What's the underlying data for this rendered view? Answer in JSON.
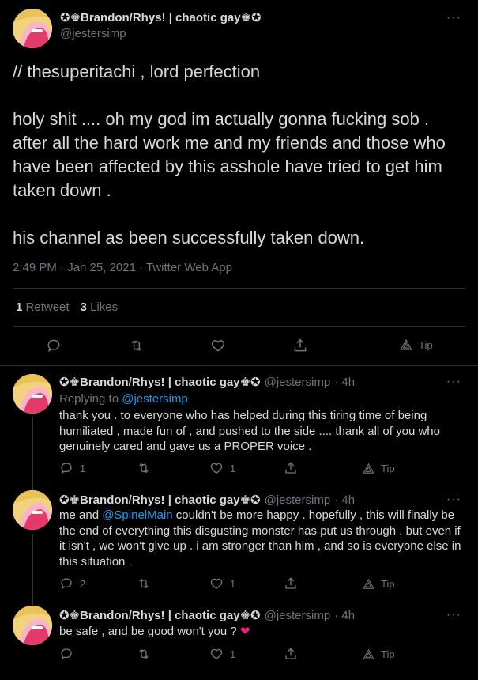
{
  "main_tweet": {
    "display_name": "✪♚Brandon/Rhys! | chaotic gay♚✪",
    "handle": "@jestersimp",
    "text": "// thesuperitachi , lord perfection\n\nholy shit .... oh my god im actually gonna fucking sob . after all the hard work me and my friends and those who have been affected by this asshole have tried to get him taken down .\n\nhis channel as been successfully taken down.",
    "time": "2:49 PM · Jan 25, 2021 · Twitter Web App",
    "retweets_count": "1",
    "retweets_label": "Retweet",
    "likes_count": "3",
    "likes_label": "Likes",
    "tip_label": "Tip"
  },
  "replies": [
    {
      "display_name": "✪♚Brandon/Rhys! | chaotic gay♚✪",
      "handle": "@jestersimp",
      "time": "· 4h",
      "replying_prefix": "Replying to",
      "replying_to": "@jestersimp",
      "text": "thank you . to everyone who has helped during this tiring time of being humiliated , made fun of , and pushed to the side .... thank all of you who genuinely cared and gave us a PROPER voice .",
      "reply_count": "1",
      "retweet_count": "",
      "like_count": "1",
      "tip_label": "Tip"
    },
    {
      "display_name": "✪♚Brandon/Rhys! | chaotic gay♚✪",
      "handle": "@jestersimp",
      "time": "· 4h",
      "text_before": "me and ",
      "mention": "@SpinelMain",
      "text_after": " couldn't be more happy . hopefully , this will finally be the end of everything this disgusting monster has put us through . but even if it isn't , we won't give up . i am stronger than him , and so is everyone else in this situation .",
      "reply_count": "2",
      "retweet_count": "",
      "like_count": "1",
      "tip_label": "Tip"
    },
    {
      "display_name": "✪♚Brandon/Rhys! | chaotic gay♚✪",
      "handle": "@jestersimp",
      "time": "· 4h",
      "text": "be safe , and be good won't you ?",
      "emoji": "❤",
      "reply_count": "",
      "retweet_count": "",
      "like_count": "1",
      "tip_label": "Tip"
    }
  ],
  "colors": {
    "background": "#000000",
    "text": "#d9d9d9",
    "secondary": "#6e767d",
    "link": "#1d9bf0",
    "border": "#2f3336",
    "heart": "#f91880"
  },
  "icons": [
    "more-icon",
    "reply-icon",
    "retweet-icon",
    "like-icon",
    "share-icon",
    "tip-icon"
  ]
}
